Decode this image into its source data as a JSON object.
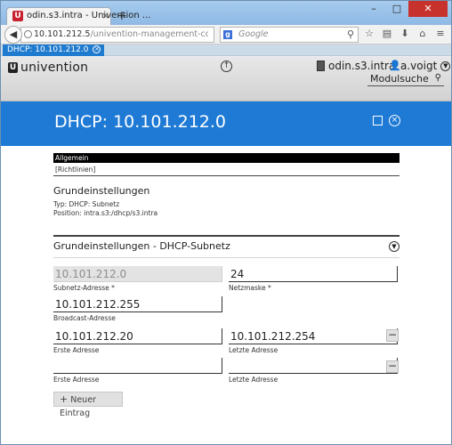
{
  "browser": {
    "tab_title": "odin.s3.intra - Univention ...",
    "tab_favicon": "U",
    "tab_close": "×",
    "new_tab": "+",
    "url_host": "10.101.212.5",
    "url_path": "/univention-management-console/?lang=de-DE",
    "search_placeholder": "Google",
    "search_engine_letter": "g",
    "window_controls": [
      "–",
      "□",
      "✕"
    ]
  },
  "module_tab": {
    "label": "DHCP: 10.101.212.0"
  },
  "umc": {
    "logo_text": "univention",
    "logo_mark": "U",
    "host": "odin.s3.intra",
    "user": "a.voigt",
    "module_search": "Modulsuche"
  },
  "page": {
    "title": "DHCP: 10.101.212.0",
    "tabs": [
      "Allgemein",
      "[Richtlinien]"
    ],
    "section1": {
      "title": "Grundeinstellungen",
      "type_line": "Typ: DHCP: Subnetz",
      "position_line": "Position: intra.s3:/dhcp/s3.intra"
    },
    "section2": {
      "title": "Grundeinstellungen - DHCP-Subnetz"
    },
    "fields": {
      "subnet": {
        "value": "10.101.212.0",
        "label": "Subnetz-Adresse *"
      },
      "netmask": {
        "value": "24",
        "label": "Netzmaske *"
      },
      "broadcast": {
        "value": "10.101.212.255",
        "label": "Broadcast-Adresse"
      },
      "ranges": [
        {
          "first": "10.101.212.20",
          "last": "10.101.212.254",
          "first_label": "Erste Adresse",
          "last_label": "Letzte Adresse"
        },
        {
          "first": "",
          "last": "",
          "first_label": "Erste Adresse",
          "last_label": "Letzte Adresse"
        }
      ]
    },
    "add_entry_button": "Neuer Eintrag"
  }
}
